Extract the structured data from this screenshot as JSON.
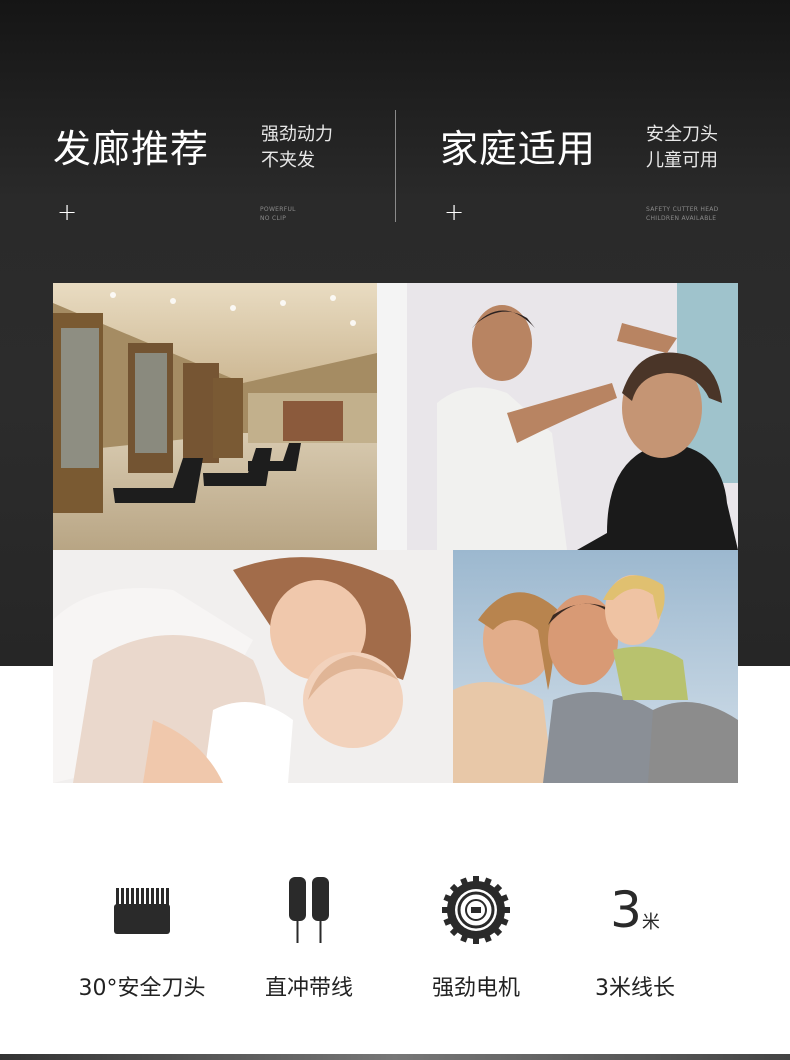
{
  "header": {
    "left": {
      "title": "发廊推荐",
      "sub_line1": "强劲动力",
      "sub_line2": "不夹发",
      "en_line1": "POWERFUL",
      "en_line2": "NO CLIP",
      "plus": "+"
    },
    "right": {
      "title": "家庭适用",
      "sub_line1": "安全刀头",
      "sub_line2": "儿童可用",
      "en_line1": "SAFETY CUTTER HEAD",
      "en_line2": "CHILDREN AVAILABLE",
      "plus": "+"
    }
  },
  "features": [
    {
      "icon": "comb-blade-icon",
      "label": "30°安全刀头"
    },
    {
      "icon": "power-cord-icon",
      "label": "直冲带线"
    },
    {
      "icon": "motor-gear-icon",
      "label": "强劲电机"
    },
    {
      "icon": "three-meter-icon",
      "label": "3米线长",
      "icon_number": "3",
      "icon_unit": "米"
    }
  ],
  "colors": {
    "hero_bg": "#2a2a2a",
    "text_light": "#ffffff",
    "text_dark": "#222222"
  }
}
